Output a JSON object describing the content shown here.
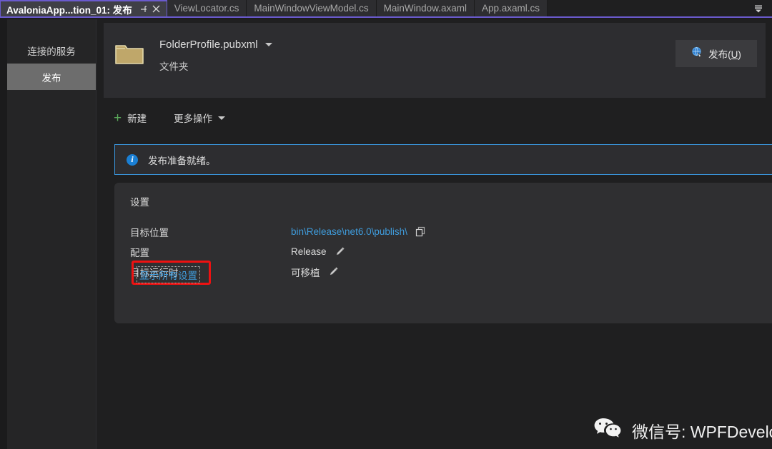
{
  "window": {
    "accent_purple": "#6a5acd",
    "background": "#1b1b1c"
  },
  "tabbar": {
    "tabs": [
      {
        "label": "AvaloniaApp...tion_01: 发布",
        "active": true,
        "pin_icon": "pin-icon",
        "close_icon": "close-icon"
      },
      {
        "label": "ViewLocator.cs",
        "active": false
      },
      {
        "label": "MainWindowViewModel.cs",
        "active": false
      },
      {
        "label": "MainWindow.axaml",
        "active": false
      },
      {
        "label": "App.axaml.cs",
        "active": false
      }
    ],
    "overflow_icon": "chevron-double-down-icon"
  },
  "sidebar": {
    "items": [
      {
        "label": "连接的服务",
        "selected": false
      },
      {
        "label": "发布",
        "selected": true
      }
    ]
  },
  "profile": {
    "icon": "folder-icon",
    "name": "FolderProfile.pubxml",
    "dropdown_icon": "chevron-down-icon",
    "subtitle": "文件夹",
    "publish_button": {
      "icon": "publish-globe-icon",
      "label_prefix": "发布(",
      "label_key": "U",
      "label_suffix": ")"
    }
  },
  "toolbar": {
    "new_icon": "plus-icon",
    "new_label": "新建",
    "more_actions_label": "更多操作",
    "more_actions_icon": "chevron-down-icon"
  },
  "banner": {
    "icon": "info-icon",
    "text": "发布准备就绪。",
    "border_color": "#3a96dd"
  },
  "settings": {
    "title": "设置",
    "rows": [
      {
        "label": "目标位置",
        "value": "bin\\Release\\net6.0\\publish\\",
        "value_is_link": true,
        "action_icon": "copy-icon"
      },
      {
        "label": "配置",
        "value": "Release",
        "value_is_link": false,
        "action_icon": "pencil-icon"
      },
      {
        "label": "目标运行时",
        "value": "可移植",
        "value_is_link": false,
        "action_icon": "pencil-icon"
      }
    ],
    "show_all_link": "显示所有设置",
    "highlight_color": "#ee1111"
  },
  "watermark": {
    "icon": "wechat-icon",
    "text": "微信号: WPFDevelopers"
  }
}
